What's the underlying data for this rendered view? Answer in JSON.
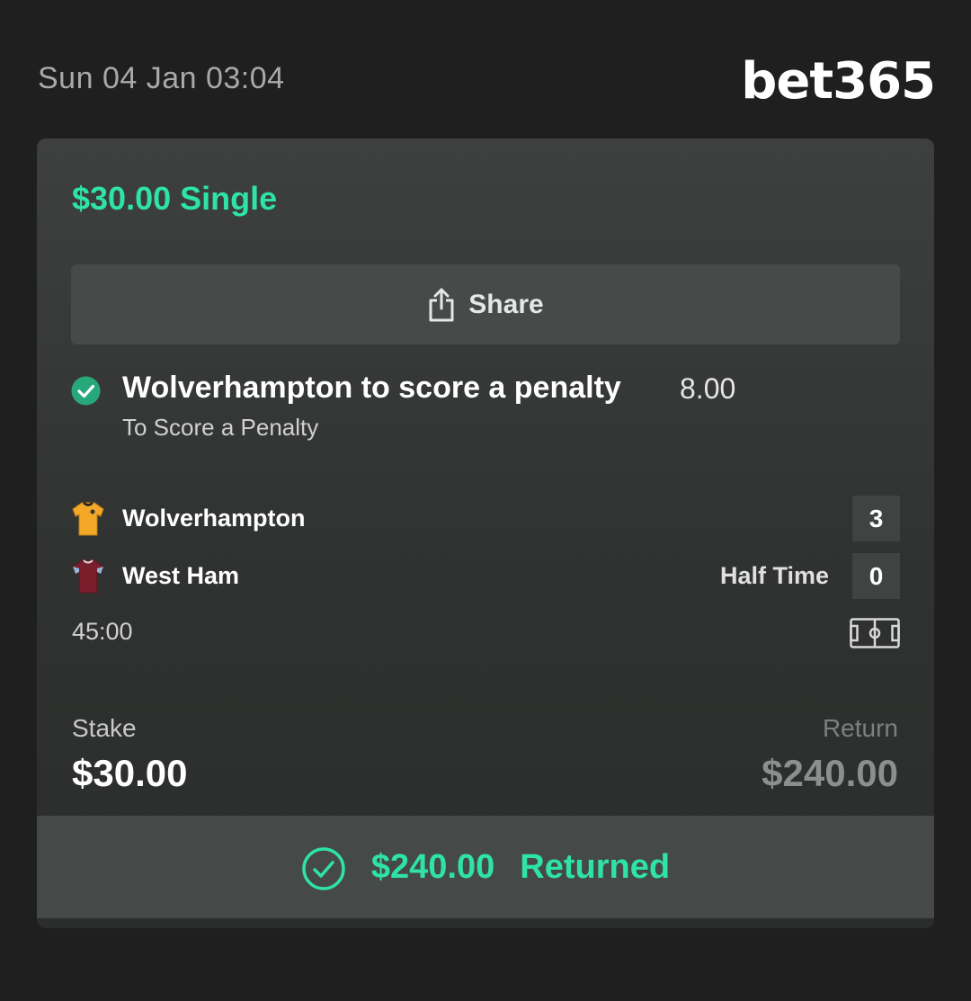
{
  "header": {
    "datetime": "Sun 04 Jan 03:04",
    "brand": "bet365"
  },
  "bet": {
    "title": "$30.00 Single",
    "share_label": "Share",
    "selection": {
      "name": "Wolverhampton to score a penalty",
      "odds": "8.00",
      "market": "To Score a Penalty",
      "status_icon": "check-circle-icon"
    },
    "match": {
      "home_team": {
        "name": "Wolverhampton",
        "score": "3",
        "jersey_color": "#f4a828"
      },
      "away_team": {
        "name": "West Ham",
        "score": "0",
        "jersey_color": "#7a1e2c"
      },
      "period": "Half Time",
      "clock": "45:00",
      "pitch_icon": "pitch-icon"
    },
    "stake": {
      "label": "Stake",
      "value": "$30.00"
    },
    "return": {
      "label": "Return",
      "value": "$240.00"
    },
    "result": {
      "amount": "$240.00",
      "status": "Returned",
      "icon": "check-circle-outline-icon"
    }
  },
  "colors": {
    "accent_green": "#2fe3a6",
    "background": "#1f1f1f",
    "card": "#3a3d3b"
  }
}
